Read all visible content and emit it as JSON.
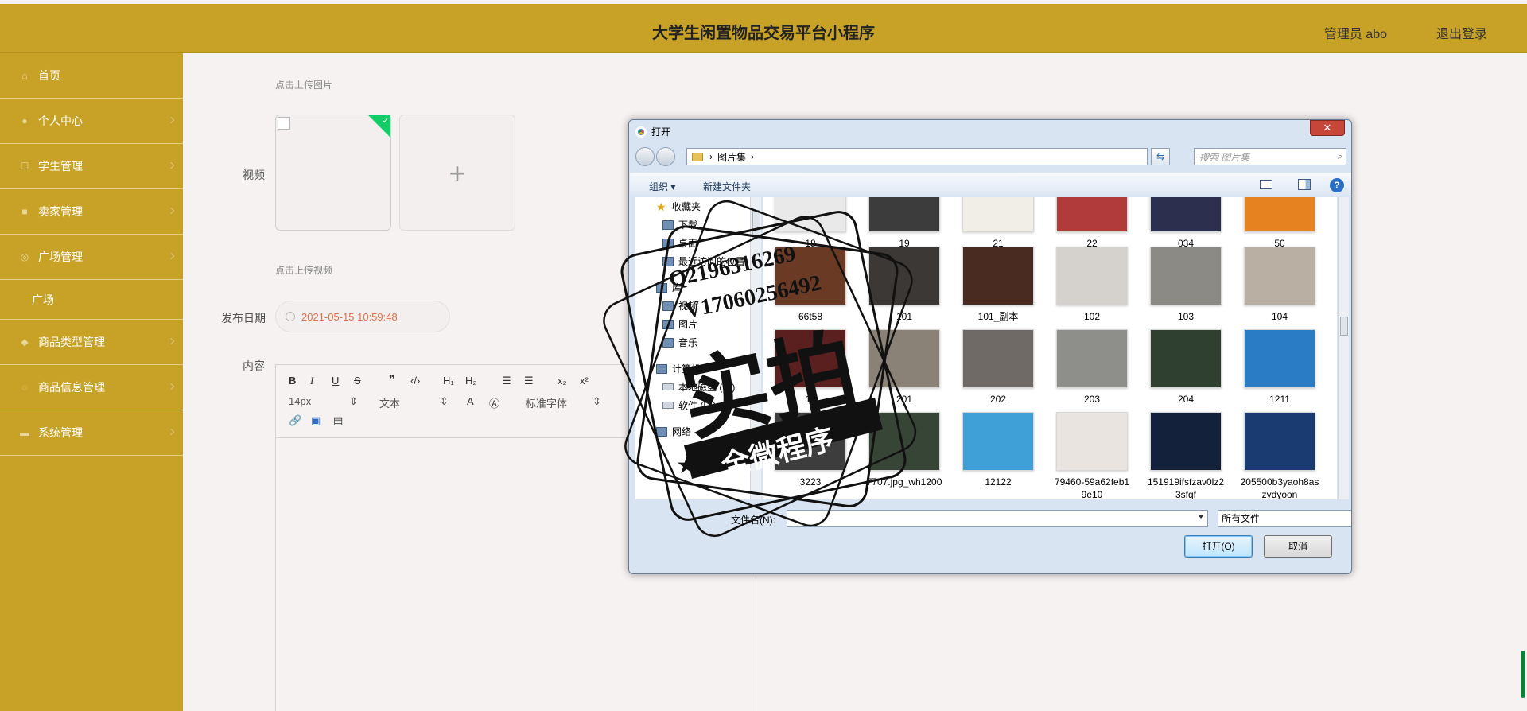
{
  "header": {
    "title": "大学生闲置物品交易平台小程序",
    "user": "管理员 abo",
    "logout": "退出登录"
  },
  "sidebar": {
    "items": [
      {
        "label": "首页",
        "icon": "home-icon"
      },
      {
        "label": "个人中心",
        "icon": "user-icon"
      },
      {
        "label": "学生管理",
        "icon": "list-icon"
      },
      {
        "label": "卖家管理",
        "icon": "book-icon"
      },
      {
        "label": "广场管理",
        "icon": "compass-icon"
      },
      {
        "label": "广场",
        "icon": ""
      },
      {
        "label": "商品类型管理",
        "icon": "tag-icon"
      },
      {
        "label": "商品信息管理",
        "icon": "info-icon"
      },
      {
        "label": "系统管理",
        "icon": "cog-icon"
      }
    ]
  },
  "form": {
    "upload_image_hint": "点击上传图片",
    "video_label": "视频",
    "upload_video_hint": "点击上传视频",
    "date_label": "发布日期",
    "date_value": "2021-05-15 10:59:48",
    "content_label": "内容",
    "toolbar": {
      "font_size": "14px",
      "format": "文本",
      "font_family": "标准字体",
      "h1": "H₁",
      "h2": "H₂",
      "sub": "x₂",
      "sup": "x²"
    }
  },
  "dialog": {
    "title": "打开",
    "close": "✕",
    "path": "图片集",
    "search_placeholder": "搜索 图片集",
    "organize": "组织 ▾",
    "new_folder": "新建文件夹",
    "nav": [
      {
        "label": "收藏夹",
        "icon": "star-icon"
      },
      {
        "label": "下载",
        "icon": "download-icon"
      },
      {
        "label": "桌面",
        "icon": "desktop-icon"
      },
      {
        "label": "最近访问的位置",
        "icon": "recent-icon"
      },
      {
        "label": "库",
        "icon": "library-icon"
      },
      {
        "label": "视频",
        "icon": "video-icon"
      },
      {
        "label": "图片",
        "icon": "picture-icon"
      },
      {
        "label": "音乐",
        "icon": "music-icon"
      },
      {
        "label": "计算机",
        "icon": "computer-icon"
      },
      {
        "label": "本地磁盘 (C:)",
        "icon": "drive-icon"
      },
      {
        "label": "软件 (D:)",
        "icon": "drive-icon"
      },
      {
        "label": "网络",
        "icon": "network-icon"
      }
    ],
    "files": [
      {
        "name": "18",
        "color": "#e9e9e9"
      },
      {
        "name": "19",
        "color": "#3c3c3c"
      },
      {
        "name": "21",
        "color": "#f1eee8"
      },
      {
        "name": "22",
        "color": "#b13a3a"
      },
      {
        "name": "034",
        "color": "#2c2f4d"
      },
      {
        "name": "50",
        "color": "#e6821f"
      },
      {
        "name": "66t58",
        "color": "#6a3a24"
      },
      {
        "name": "101",
        "color": "#3b3835"
      },
      {
        "name": "101_副本",
        "color": "#4a2b22"
      },
      {
        "name": "102",
        "color": "#d5d2cd"
      },
      {
        "name": "103",
        "color": "#8c8a84"
      },
      {
        "name": "104",
        "color": "#b9afa3"
      },
      {
        "name": "11",
        "color": "#5a1f1f"
      },
      {
        "name": "201",
        "color": "#8a8277"
      },
      {
        "name": "202",
        "color": "#6f6a66"
      },
      {
        "name": "203",
        "color": "#8e8f8a"
      },
      {
        "name": "204",
        "color": "#2f4030"
      },
      {
        "name": "1211",
        "color": "#2a7cc4"
      },
      {
        "name": "3223",
        "color": "#3d3d3d"
      },
      {
        "name": "7707.jpg_wh1200",
        "color": "#374536"
      },
      {
        "name": "12122",
        "color": "#3ea0d6"
      },
      {
        "name": "79460-59a62feb19e10",
        "color": "#e9e4e0"
      },
      {
        "name": "151919ifsfzav0lz23sfqf",
        "color": "#13223a"
      },
      {
        "name": "205500b3yaoh8aszydyoon",
        "color": "#1a3a72"
      }
    ],
    "filename_label": "文件名(N):",
    "filetype": "所有文件",
    "open_button": "打开(O)",
    "cancel_button": "取消"
  },
  "watermark": {
    "line1": "Q2196316269",
    "line2": "V17060256492",
    "main": "实拍",
    "banner": "全微程序"
  }
}
